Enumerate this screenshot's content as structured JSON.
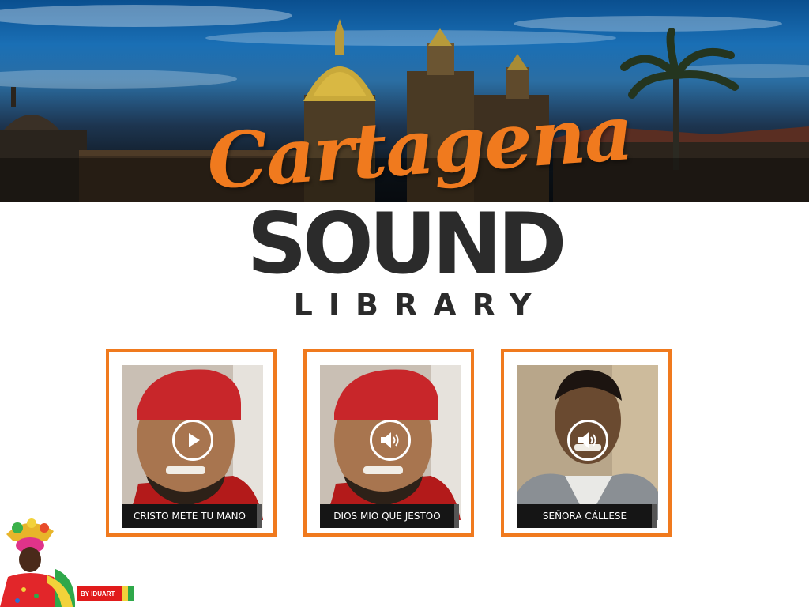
{
  "header": {
    "title_script": "Cartagena",
    "title_main": "SOUND",
    "title_sub": "LIBRARY"
  },
  "sounds": [
    {
      "label": "CRISTO METE TU MANO",
      "control_icon": "play-icon"
    },
    {
      "label": "DIOS MIO QUE JESTOO",
      "control_icon": "speaker-icon"
    },
    {
      "label": "SEÑORA CÁLLESE",
      "control_icon": "speaker-icon"
    }
  ],
  "footer": {
    "credit": "BY IDUART"
  },
  "colors": {
    "accent": "#f07a1e",
    "dark": "#2b2b2b",
    "caption_bg": "#151515",
    "credit_bg": "#e11b1b"
  }
}
